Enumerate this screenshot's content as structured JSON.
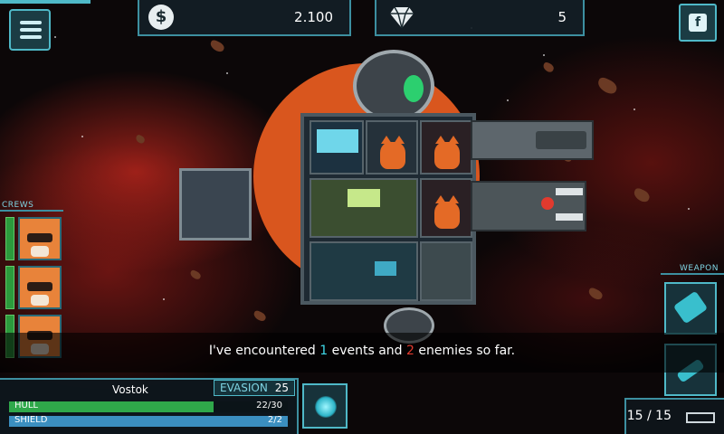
{
  "top": {
    "credits": "2.100",
    "gems": "5",
    "credits_icon": "dollar-coin-icon",
    "gems_icon": "diamond-icon",
    "menu_icon": "menu-list-icon",
    "share_icon": "facebook-share-icon"
  },
  "crews": {
    "label": "CREWS",
    "members": [
      {
        "health": 1.0
      },
      {
        "health": 1.0
      },
      {
        "health": 1.0
      }
    ]
  },
  "weapons": {
    "label": "WEAPON",
    "slots": [
      {
        "icon": "laser-cannon-icon"
      },
      {
        "icon": "missile-icon"
      }
    ]
  },
  "message": {
    "part1": "I've encountered ",
    "events": "1",
    "part2": " events and ",
    "enemies": "2",
    "part3": " enemies so far."
  },
  "ship": {
    "name": "Vostok",
    "evasion_label": "EVASION",
    "evasion": "25",
    "hull_label": "HULL",
    "hull_value": "22/30",
    "hull_fraction": 0.7333,
    "shield_label": "SHIELD",
    "shield_value": "2/2",
    "shield_fraction": 1.0,
    "skill_icon": "shield-orb-icon"
  },
  "ammo": {
    "value": "15 / 15",
    "icon": "battery-icon"
  },
  "colors": {
    "accent": "#4fb9c8",
    "hull_bar": "#2fa84a",
    "shield_bar": "#3b8fc0",
    "highlight_cyan": "#3fd8e8",
    "highlight_red": "#e23a2e"
  }
}
